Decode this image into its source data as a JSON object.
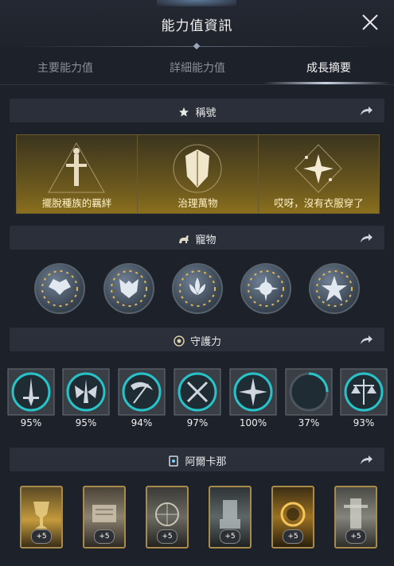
{
  "header": {
    "title": "能力值資訊"
  },
  "tabs": [
    {
      "label": "主要能力值"
    },
    {
      "label": "詳細能力值"
    },
    {
      "label": "成長摘要"
    }
  ],
  "sections": {
    "titles": {
      "label": "稱號"
    },
    "pets": {
      "label": "寵物"
    },
    "guardian": {
      "label": "守護力"
    },
    "arcana": {
      "label": "阿爾卡那"
    }
  },
  "titles": [
    {
      "label": "擺脫種族的羈絆"
    },
    {
      "label": "治理萬物"
    },
    {
      "label": "哎呀，沒有衣服穿了"
    }
  ],
  "guardians": [
    {
      "percent": "95%"
    },
    {
      "percent": "95%"
    },
    {
      "percent": "94%"
    },
    {
      "percent": "97%"
    },
    {
      "percent": "100%"
    },
    {
      "percent": "37%"
    },
    {
      "percent": "93%"
    }
  ],
  "arcana": [
    {
      "badge": "+5"
    },
    {
      "badge": "+5"
    },
    {
      "badge": "+5"
    },
    {
      "badge": "+5"
    },
    {
      "badge": "+5"
    },
    {
      "badge": "+5"
    }
  ],
  "colors": {
    "accent_gold": "#8a6f1d",
    "ring_cyan": "#27c3c9",
    "section_bg": "#2a2f3a"
  }
}
